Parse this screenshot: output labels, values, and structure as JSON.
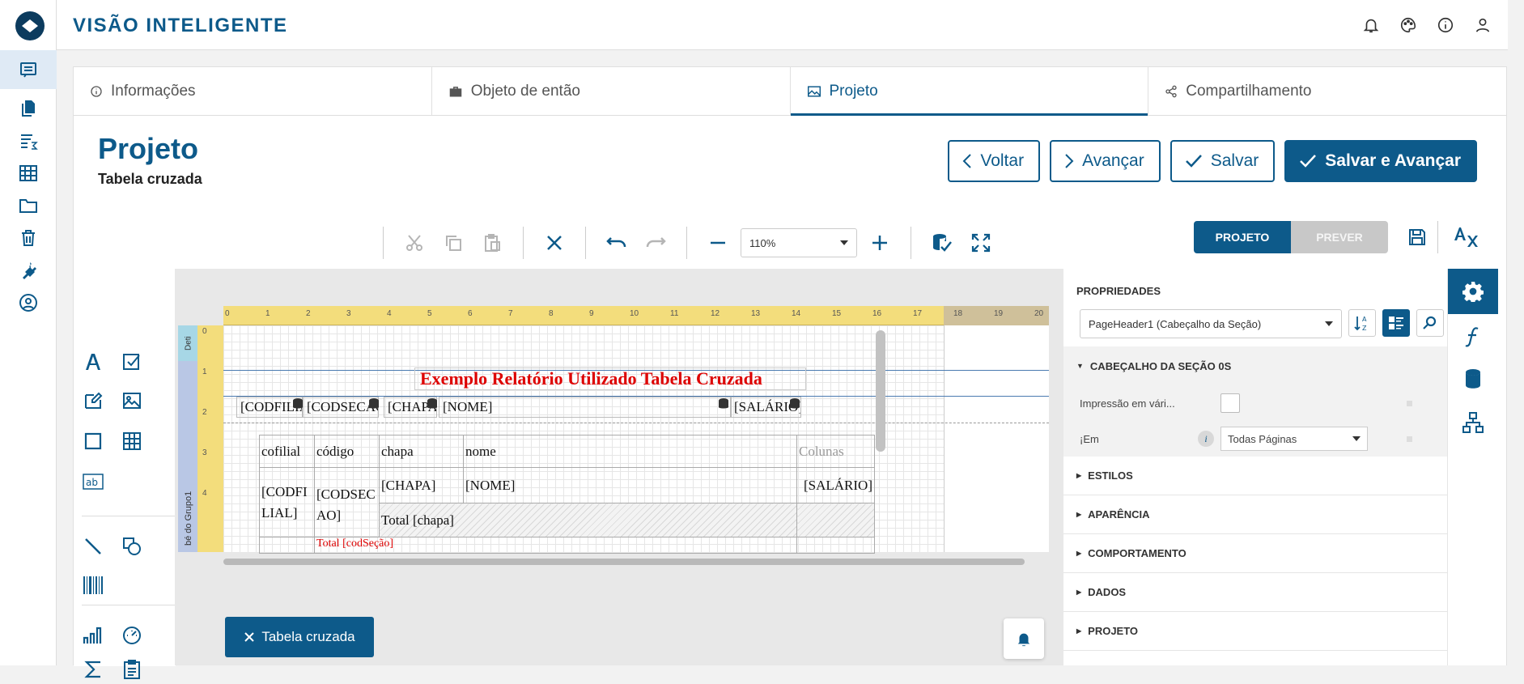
{
  "app": {
    "title": "VISÃO INTELIGENTE"
  },
  "rail": {
    "items": [
      "reports-icon",
      "documents-icon",
      "sum-list-icon",
      "grid-icon",
      "folder-icon",
      "trash-icon",
      "plug-icon",
      "user-settings-icon"
    ]
  },
  "header_icons": [
    "bell-icon",
    "palette-icon",
    "info-icon",
    "user-icon"
  ],
  "tabs": [
    {
      "label": "Informações",
      "icon": "info-icon"
    },
    {
      "label": "Objeto de então",
      "icon": "briefcase-icon"
    },
    {
      "label": "Projeto",
      "icon": "image-icon",
      "active": true
    },
    {
      "label": "Compartilhamento",
      "icon": "share-icon"
    }
  ],
  "page": {
    "title": "Projeto",
    "subtitle": "Tabela cruzada"
  },
  "actions": {
    "back": "Voltar",
    "next": "Avançar",
    "save": "Salvar",
    "save_next": "Salvar e Avançar"
  },
  "toolbar": {
    "zoom": "110%"
  },
  "mode": {
    "design": "PROJETO",
    "preview": "PREVER"
  },
  "designer": {
    "band_data": "Deti",
    "band_group": "bé do Grupo1",
    "ruler_top": [
      "0",
      "1",
      "2",
      "3",
      "4",
      "5",
      "6",
      "7",
      "8",
      "9",
      "10",
      "11",
      "12",
      "13",
      "14",
      "15",
      "16",
      "17",
      "18",
      "19",
      "20"
    ],
    "ruler_left": [
      "0",
      "1",
      "2",
      "3",
      "4"
    ],
    "report_title": "Exemplo Relatório Utilizado Tabela Cruzada",
    "fields": {
      "codfilial": "[CODFILIAL]",
      "codsecao": "[CODSECAO]",
      "chapa": "[CHAPA]",
      "nome": "[NOME]",
      "salario": "[SALÁRIO]"
    },
    "crosstab": {
      "headers": {
        "cofilial": "cofilial",
        "codigo": "código",
        "chapa": "chapa",
        "nome": "nome",
        "colunas": "Colunas"
      },
      "row": {
        "codfilial": "[CODFI LIAL]",
        "codsecao": "[CODSEC AO]",
        "chapa": "[CHAPA]",
        "nome": "[NOME]",
        "salario": "[SALÁRIO]"
      },
      "total_chapa": "Total [chapa]",
      "total_partial": "Total [codSeção]"
    }
  },
  "chip": {
    "label": "Tabela cruzada"
  },
  "properties": {
    "heading": "PROPRIEDADES",
    "selected": "PageHeader1 (Cabeçalho da Seção)",
    "section_open": "CABEÇALHO DA SEÇÃO 0S",
    "rows": [
      {
        "label": "Impressão em vári...",
        "type": "checkbox"
      },
      {
        "label": "¡Em",
        "value": "Todas Páginas",
        "type": "select"
      }
    ],
    "sections": [
      "ESTILOS",
      "APARÊNCIA",
      "COMPORTAMENTO",
      "DADOS",
      "PROJETO"
    ]
  },
  "sidebar_right": [
    "gear-icon",
    "function-icon",
    "database-icon",
    "hierarchy-icon"
  ],
  "colors": {
    "brand": "#0d5a8a",
    "accent_red": "#dd0000"
  }
}
